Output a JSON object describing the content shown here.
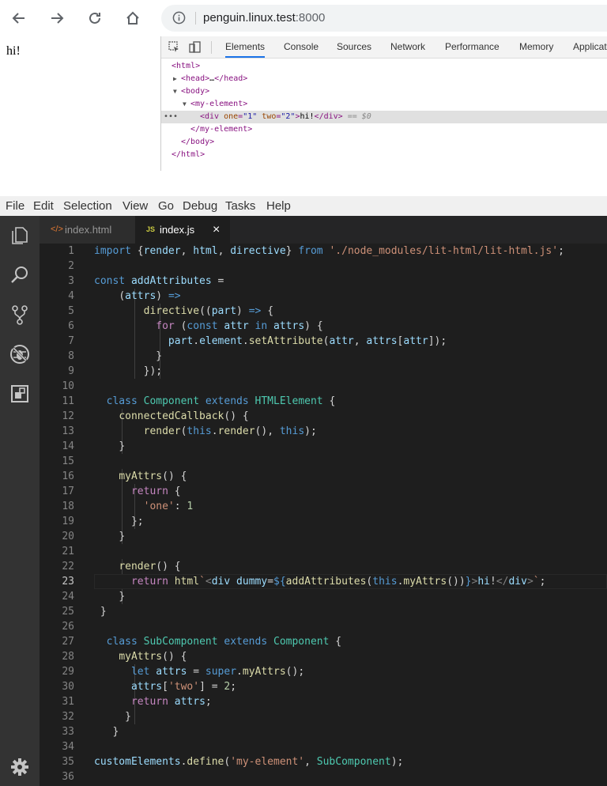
{
  "browser": {
    "url_host": "penguin.linux.test",
    "url_port": ":8000"
  },
  "page": {
    "text": "hi!"
  },
  "devtools": {
    "tabs": [
      "Elements",
      "Console",
      "Sources",
      "Network",
      "Performance",
      "Memory",
      "Applicat"
    ],
    "active_tab": "Elements",
    "dom": [
      {
        "indent": 0,
        "tri": "",
        "html": "<html>"
      },
      {
        "indent": 1,
        "tri": "▶",
        "html": "<head>…</head>"
      },
      {
        "indent": 1,
        "tri": "▼",
        "html": "<body>"
      },
      {
        "indent": 2,
        "tri": "▼",
        "html": "<my-element>"
      },
      {
        "indent": 3,
        "tri": "",
        "html": "<div one=\"1\" two=\"2\">hi!</div> == $0",
        "selected": true
      },
      {
        "indent": 2,
        "tri": "",
        "html": "</my-element>"
      },
      {
        "indent": 1,
        "tri": "",
        "html": "</body>"
      },
      {
        "indent": 0,
        "tri": "",
        "html": "</html>"
      }
    ],
    "selected_suffix": "== $0"
  },
  "menubar": [
    "File",
    "Edit",
    "Selection",
    "View",
    "Go",
    "Debug",
    "Tasks",
    "Help"
  ],
  "editor_tabs": [
    {
      "label": "index.html",
      "icon": "html-file-icon",
      "active": false
    },
    {
      "label": "index.js",
      "icon": "js-file-icon",
      "active": true
    }
  ],
  "close_glyph": "×",
  "current_line": 23,
  "code": [
    "import {render, html, directive} from './node_modules/lit-html/lit-html.js';",
    "",
    "const addAttributes =",
    "    (attrs) =>",
    "        directive((part) => {",
    "          for (const attr in attrs) {",
    "            part.element.setAttribute(attr, attrs[attr]);",
    "          }",
    "        });",
    "",
    "  class Component extends HTMLElement {",
    "    connectedCallback() {",
    "        render(this.render(), this);",
    "    }",
    "",
    "    myAttrs() {",
    "      return {",
    "        'one': 1",
    "      };",
    "    }",
    "",
    "    render() {",
    "      return html`<div dummy=${addAttributes(this.myAttrs())}>hi!</div>`;",
    "    }",
    " }",
    "",
    "  class SubComponent extends Component {",
    "    myAttrs() {",
    "      let attrs = super.myAttrs();",
    "      attrs['two'] = 2;",
    "      return attrs;",
    "     }",
    "   }",
    "",
    "customElements.define('my-element', SubComponent);",
    ""
  ],
  "colors": {
    "keyword": "#569cd6",
    "control": "#c586c0",
    "function": "#dcdcaa",
    "variable": "#9cdcfe",
    "class": "#4ec9b0",
    "string": "#ce9178",
    "number": "#b5cea8"
  }
}
